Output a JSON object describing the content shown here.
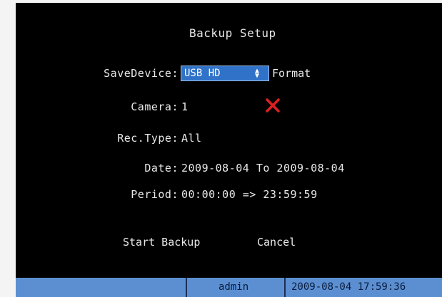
{
  "dialog": {
    "title": "Backup Setup",
    "save_device": {
      "label": "SaveDevice:",
      "value": "USB HD"
    },
    "format_label": "Format",
    "camera": {
      "label": "Camera:",
      "value": "1"
    },
    "rec_type": {
      "label": "Rec.Type:",
      "value": "All"
    },
    "date": {
      "label": "Date:",
      "value": "2009-08-04 To 2009-08-04"
    },
    "period": {
      "label": "Period:",
      "value": "00:00:00 => 23:59:59"
    },
    "start_backup_label": "Start Backup",
    "cancel_label": "Cancel",
    "status_icon": "red-x-icon",
    "status_color": "#e02020"
  },
  "statusbar": {
    "user": "admin",
    "datetime": "2009-08-04 17:59:36"
  }
}
